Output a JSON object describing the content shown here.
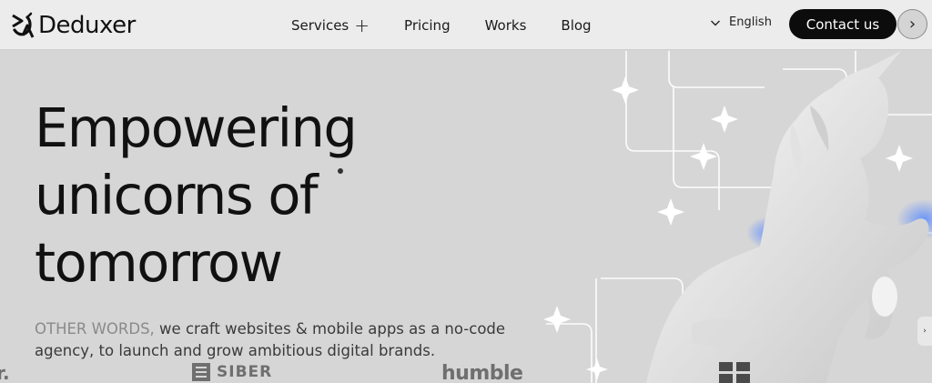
{
  "brand": {
    "name": "Deduxer"
  },
  "nav": {
    "items": [
      {
        "label": "Services"
      },
      {
        "label": "Pricing"
      },
      {
        "label": "Works"
      },
      {
        "label": "Blog"
      }
    ],
    "services_expand_glyph": "+"
  },
  "language": {
    "label": "English"
  },
  "header": {
    "contact_label": "Contact us",
    "next_glyph": "›"
  },
  "hero": {
    "title_lines": [
      "Empowering",
      "unicorns of",
      "tomorrow"
    ],
    "subtitle_muted": "OTHER WORDS,",
    "subtitle_rest": " we craft websites & mobile apps as a no-code agency, to launch and grow ambitious digital brands."
  },
  "clients": {
    "partial": "r.",
    "siber": "SIBER",
    "humble": "humble"
  },
  "side_tab": {
    "glyph": "›"
  },
  "colors": {
    "accent": "#0c0c0c",
    "background": "#d6d6d6",
    "header": "#ececec",
    "glow": "#4a7dff"
  }
}
